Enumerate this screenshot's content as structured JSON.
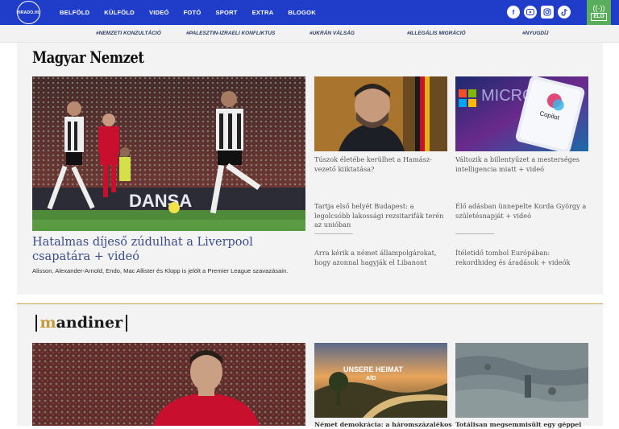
{
  "nav": {
    "logo_text": "HIRADO.HU",
    "links": [
      "BELFÖLD",
      "KÜLFÖLD",
      "VIDEÓ",
      "FOTÓ",
      "SPORT",
      "EXTRA",
      "BLOGOK"
    ],
    "socials": [
      "facebook-icon",
      "youtube-icon",
      "instagram-icon",
      "tiktok-icon"
    ],
    "live_label": "ÉLŐ"
  },
  "tags": [
    "#NEMZETI KONZULTÁCIÓ",
    "#PALESZTIN-IZRAELI KONFLIKTUS",
    "#UKRÁN VÁLSÁG",
    "#ILLEGÁLIS MIGRÁCIÓ",
    "#NYUGDÍJ"
  ],
  "section1": {
    "brand": "Magyar Nemzet",
    "main": {
      "title": "Hatalmas díjeső zúdulhat a Liverpool csapatára + videó",
      "lead": "Alisson, Alexander-Arnold, Endo, Mac Allister és Klopp is jelölt a Premier League szavazásain.",
      "image_banner": "DANSA"
    },
    "cards": [
      {
        "title": "Túszok életébe kerülhet a Hamász-vezető kiiktatása?"
      },
      {
        "title": "Változik a billentyűzet a mesterséges intelligencia miatt + videó",
        "image_text": "Copilot"
      },
      {
        "title": "Tartja első helyét Budapest: a legolcsóbb lakossági rezsitarifák terén az unióban"
      },
      {
        "title": "Élő adásban ünnepelte Korda György a születésnapját + videó"
      },
      {
        "title": "Arra kérik a német állampolgárokat, hogy azonnal hagyják el Libanont"
      },
      {
        "title": "Ítéletidő tombol Európában: rekordhideg és áradások + videók"
      }
    ]
  },
  "section2": {
    "brand_first": "m",
    "brand_rest": "andiner",
    "cards": [
      {
        "title": "Német demokrácia: a háromszázalékos",
        "image_text": "UNSERE HEIMAT",
        "image_sub": "AfD"
      },
      {
        "title": "Totálisan megsemmisült egy géppel"
      }
    ]
  }
}
